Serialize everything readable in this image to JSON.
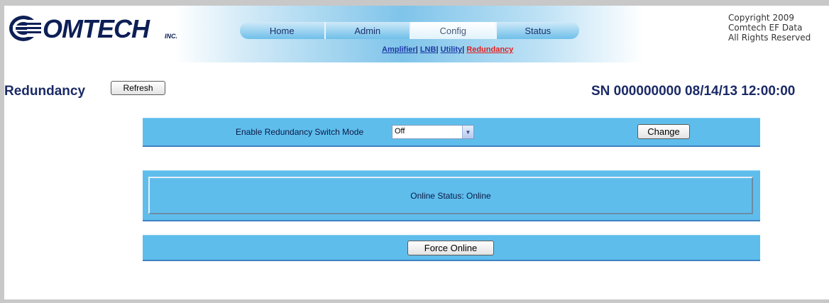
{
  "brand": {
    "logo_text": "OMTECH",
    "logo_suffix": "INC."
  },
  "nav": {
    "tabs": [
      {
        "label": "Home",
        "active": false
      },
      {
        "label": "Admin",
        "active": false
      },
      {
        "label": "Config",
        "active": true
      },
      {
        "label": "Status",
        "active": false
      }
    ],
    "subnav": [
      {
        "label": "Amplifier"
      },
      {
        "label": "LNB"
      },
      {
        "label": "Utility"
      },
      {
        "label": "Redundancy",
        "current": true
      }
    ]
  },
  "copyright": {
    "line1": "Copyright 2009",
    "line2": "Comtech EF Data",
    "line3": "All Rights Reserved"
  },
  "page": {
    "title": "Redundancy",
    "refresh_label": "Refresh",
    "serial": "SN 000000000 08/14/13 12:00:00"
  },
  "switch_mode": {
    "label": "Enable Redundancy Switch Mode",
    "selected": "Off",
    "change_label": "Change"
  },
  "status": {
    "text": "Online Status: Online"
  },
  "force": {
    "label": "Force Online"
  },
  "colors": {
    "panel": "#5fbdec",
    "title": "#1b2a66",
    "current_link": "#e02020"
  }
}
